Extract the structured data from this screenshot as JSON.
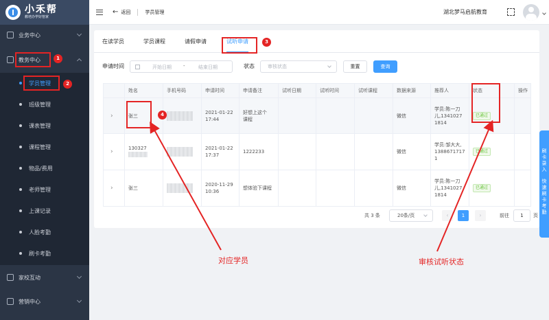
{
  "app": {
    "name": "小禾帮",
    "tagline": "教培办学好管家"
  },
  "sidebar": {
    "groups": [
      {
        "label": "业务中心"
      },
      {
        "label": "教务中心"
      },
      {
        "label": "家校互动"
      },
      {
        "label": "营销中心"
      }
    ],
    "items": [
      {
        "label": "学员管理"
      },
      {
        "label": "班级管理"
      },
      {
        "label": "课表管理"
      },
      {
        "label": "课程管理"
      },
      {
        "label": "物品/费用"
      },
      {
        "label": "老师管理"
      },
      {
        "label": "上课记录"
      },
      {
        "label": "人脸考勤"
      },
      {
        "label": "刷卡考勤"
      }
    ]
  },
  "header": {
    "back_label": "返回",
    "breadcrumb": "学员管理",
    "org_name": "湖北梦马启航教育"
  },
  "tabs": [
    {
      "label": "在读学员"
    },
    {
      "label": "学员课程"
    },
    {
      "label": "请假申请"
    },
    {
      "label": "试听申请"
    }
  ],
  "filter": {
    "date_label": "申请时间",
    "date_start_placeholder": "开始日期",
    "date_sep": "-",
    "date_end_placeholder": "结束日期",
    "status_label": "状态",
    "status_placeholder": "审核状态",
    "reset_label": "重置",
    "query_label": "查询"
  },
  "table": {
    "columns": [
      "姓名",
      "手机号码",
      "申请时间",
      "申请备注",
      "试听日期",
      "试听时间",
      "试听课程",
      "数据来源",
      "推荐人",
      "状态",
      "操作"
    ],
    "rows": [
      {
        "name": "张三",
        "time1": "2021-01-22",
        "time2": "17:44",
        "note1": "好想上这个",
        "note2": "课程",
        "source": "微信",
        "ref1": "学员:陈一刀",
        "ref2": "儿,1341027",
        "ref3": "1814",
        "status": "已通过"
      },
      {
        "name": "130327",
        "time1": "2021-01-22",
        "time2": "17:37",
        "note1": "1222233",
        "note2": "",
        "source": "微信",
        "ref1": "学员:邹大大,",
        "ref2": "1388671717",
        "ref3": "1",
        "status": "已通过"
      },
      {
        "name": "张三",
        "time1": "2020-11-29",
        "time2": "10:36",
        "note1": "想体验下课程",
        "note2": "",
        "source": "微信",
        "ref1": "学员:陈一刀",
        "ref2": "儿,1341027",
        "ref3": "1814",
        "status": "已通过"
      }
    ]
  },
  "pagination": {
    "total": "共 3 条",
    "page_size": "20条/页",
    "prev": "‹",
    "current": "1",
    "next": "›",
    "goto_label": "前往",
    "goto_value": "1",
    "goto_unit": "页"
  },
  "annotations": {
    "badges": [
      "1",
      "2",
      "3",
      "4"
    ],
    "label_student": "对应学员",
    "label_status": "审核试听状态"
  },
  "float_button": {
    "text1": "刷卡录入",
    "text2": "快速刷卡考勤"
  },
  "colors": {
    "accent": "#409eff",
    "sidebar": "#2b3545",
    "annotation": "#e42424",
    "success": "#67c23a"
  }
}
